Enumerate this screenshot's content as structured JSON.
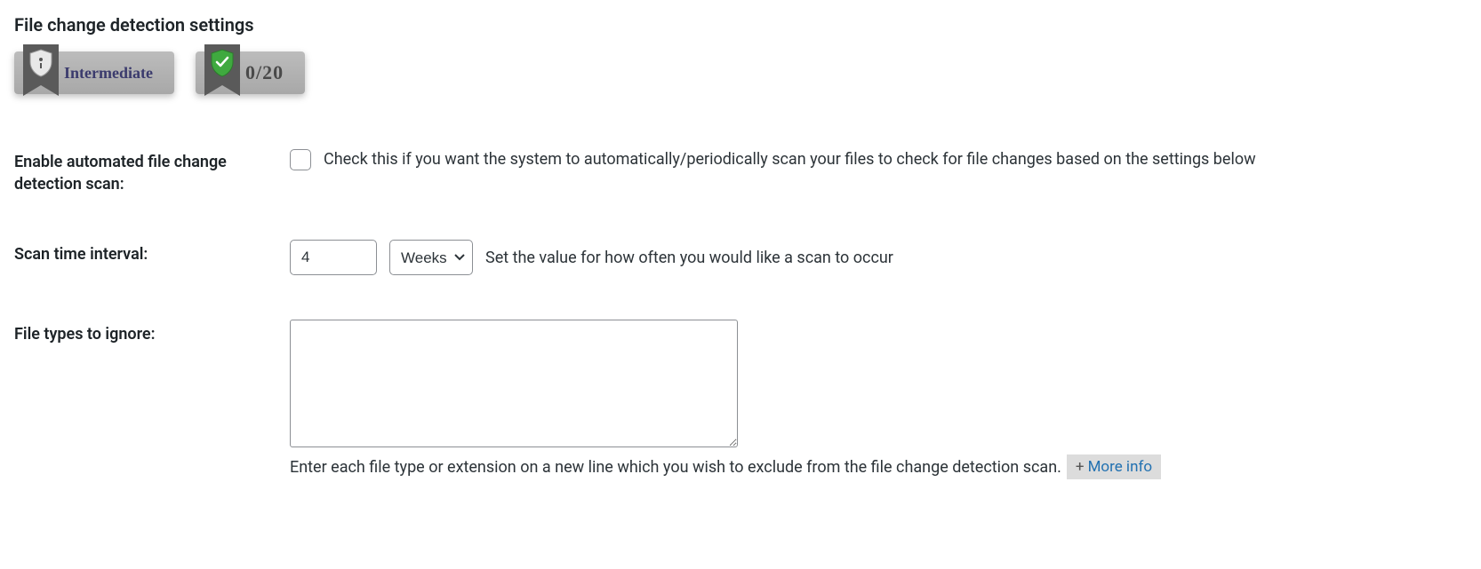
{
  "title": "File change detection settings",
  "badges": {
    "level_label": "Intermediate",
    "score_label": "0/20"
  },
  "fields": {
    "enable_scan": {
      "label": "Enable automated file change detection scan:",
      "description": "Check this if you want the system to automatically/periodically scan your files to check for file changes based on the settings below"
    },
    "interval": {
      "label": "Scan time interval:",
      "value": "4",
      "unit_selected": "Weeks",
      "description": "Set the value for how often you would like a scan to occur"
    },
    "ignore": {
      "label": "File types to ignore:",
      "value": "",
      "help": "Enter each file type or extension on a new line which you wish to exclude from the file change detection scan.",
      "more_info_prefix": "+",
      "more_info_label": "More info"
    }
  }
}
